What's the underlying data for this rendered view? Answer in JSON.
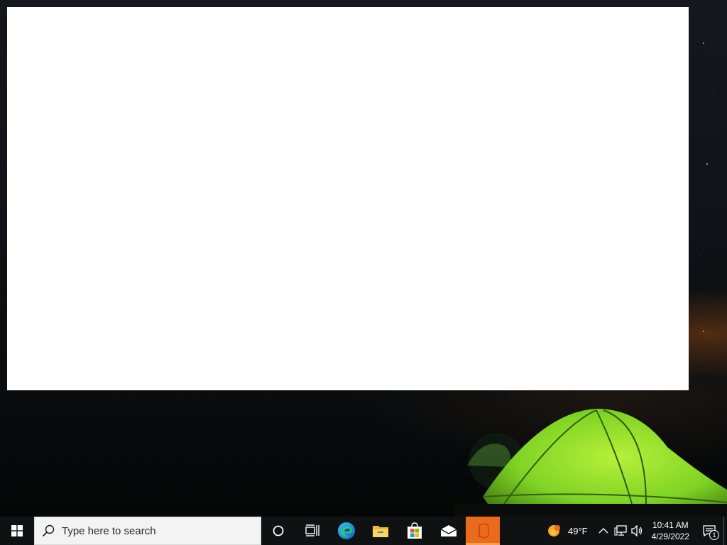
{
  "taskbar": {
    "start_icon": "windows-logo-icon",
    "search": {
      "placeholder": "Type here to search",
      "icon": "search-icon"
    },
    "pinned_apps": [
      {
        "name": "cortana",
        "icon": "circle-icon"
      },
      {
        "name": "task-view",
        "icon": "task-view-icon"
      },
      {
        "name": "edge",
        "icon": "edge-icon"
      },
      {
        "name": "file-explorer",
        "icon": "folder-icon"
      },
      {
        "name": "microsoft-store",
        "icon": "store-icon"
      },
      {
        "name": "mail",
        "icon": "mail-icon"
      },
      {
        "name": "office",
        "icon": "office-icon",
        "active": true
      }
    ],
    "active_color": "#ea6b1a"
  },
  "tray": {
    "weather": {
      "temperature": "49°F",
      "icon": "sun-cloud-icon"
    },
    "icons": [
      "chevron-up-icon",
      "network-icon",
      "volume-icon"
    ],
    "clock": {
      "time": "10:41 AM",
      "date": "4/29/2022"
    },
    "notifications": {
      "count": "1",
      "icon": "action-center-icon"
    }
  },
  "window": {
    "background": "#ffffff"
  }
}
